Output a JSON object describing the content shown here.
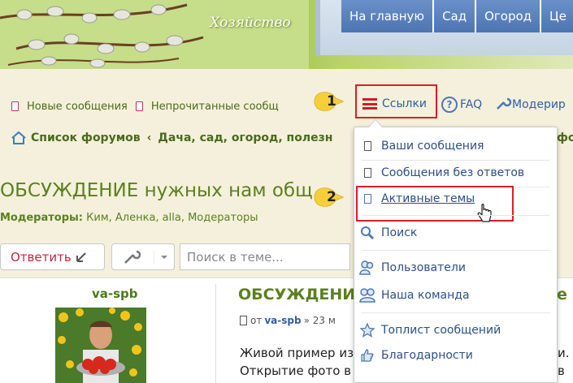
{
  "banner": {
    "site_title": "Хозяйство",
    "tabs": [
      "На главную",
      "Сад",
      "Огород",
      "Це"
    ]
  },
  "quick_links": {
    "new_posts": "Новые сообщения",
    "unread_posts": "Непрочитанные сообщ",
    "links": "Ссылки",
    "faq": "FAQ",
    "moderators": "Модерир"
  },
  "breadcrumb": {
    "forum_list": "Список форумов",
    "separator": "‹",
    "section": "Дача, сад, огород, полезн",
    "right_fragment": "фо"
  },
  "topic": {
    "title": "ОБСУЖДЕНИЕ нужных нам общ",
    "moderators_label": "Модераторы:",
    "moderators_list": "Ким, Аленка, alla, Модераторы"
  },
  "toolbar": {
    "reply": "Ответить",
    "search_placeholder": "Поиск в теме..."
  },
  "post": {
    "author": "va-spb",
    "title": "ОБСУЖДЕНИ",
    "title_right": "е",
    "meta_from": "от",
    "meta_author": "va-spb",
    "meta_rest": "» 23 м",
    "line1": "Живой пример из",
    "line1_right": "и.",
    "line2": "Открытие фото в",
    "line2_right": "в"
  },
  "dropdown": {
    "items": [
      {
        "label": "Ваши сообщения",
        "icon": "doc-edit-icon"
      },
      {
        "label": "Сообщения без ответов",
        "icon": "doc-icon"
      },
      {
        "label": "Активные темы",
        "icon": "doc-blue-icon"
      },
      {
        "label": "Поиск",
        "icon": "search-icon"
      },
      {
        "label": "Пользователи",
        "icon": "users-icon"
      },
      {
        "label": "Наша команда",
        "icon": "team-icon"
      },
      {
        "label": "Топлист сообщений",
        "icon": "star-icon"
      },
      {
        "label": "Благодарности",
        "icon": "thumbs-up-icon"
      }
    ]
  },
  "callouts": [
    "1",
    "2"
  ],
  "colors": {
    "highlight_box": "#e01b2a",
    "callout_fill": "#f5cf3a",
    "link_blue": "#2b4f8a",
    "forum_green": "#5a8020"
  }
}
